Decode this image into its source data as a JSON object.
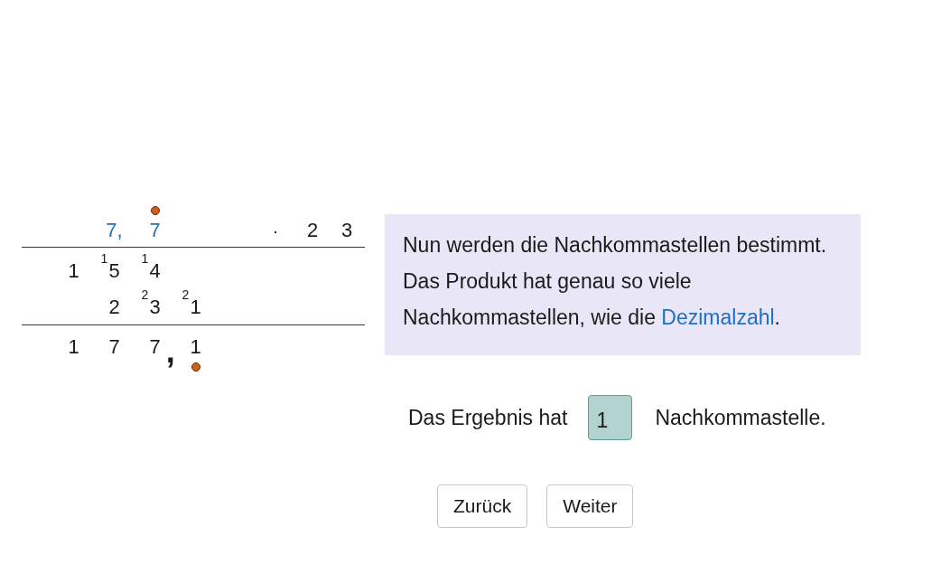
{
  "multiplication": {
    "rows": [
      {
        "kind": "factors",
        "cells": [
          {
            "kind": "gap"
          },
          {
            "kind": "digit",
            "text": "7,",
            "highlighted": true,
            "marked": false
          },
          {
            "kind": "digit",
            "text": "7",
            "highlighted": true,
            "marked": true
          },
          {
            "kind": "gap"
          },
          {
            "kind": "gap"
          },
          {
            "kind": "operator",
            "text": "·"
          },
          {
            "kind": "digit",
            "text": "2",
            "highlighted": false,
            "marked": false
          },
          {
            "kind": "digit",
            "text": "3",
            "highlighted": false,
            "marked": false
          }
        ]
      },
      {
        "kind": "partial",
        "cells": [
          {
            "kind": "digit",
            "text": "1",
            "highlighted": false,
            "marked": false
          },
          {
            "kind": "digit",
            "text": "5",
            "carry": "1",
            "highlighted": false,
            "marked": false
          },
          {
            "kind": "digit",
            "text": "4",
            "carry": "1",
            "highlighted": false,
            "marked": false
          }
        ]
      },
      {
        "kind": "partial",
        "cells": [
          {
            "kind": "gap"
          },
          {
            "kind": "digit",
            "text": "2",
            "highlighted": false,
            "marked": false
          },
          {
            "kind": "digit",
            "text": "3",
            "carry": "2",
            "highlighted": false,
            "marked": false
          },
          {
            "kind": "digit",
            "text": "1",
            "carry": "2",
            "highlighted": false,
            "marked": false
          }
        ]
      },
      {
        "kind": "result",
        "cells": [
          {
            "kind": "digit",
            "text": "1",
            "highlighted": false,
            "marked": false
          },
          {
            "kind": "digit",
            "text": "7",
            "highlighted": false,
            "marked": false
          },
          {
            "kind": "digit",
            "text": "7",
            "comma": ",",
            "highlighted": false,
            "marked": false
          },
          {
            "kind": "digit",
            "text": "1",
            "highlighted": false,
            "marked": true
          }
        ]
      }
    ]
  },
  "info_panel": {
    "parts": [
      {
        "kind": "plain",
        "text": "Nun werden die Nachkommastellen bestimmt. Das Produkt hat genau so viele Nachkommastellen, wie die "
      },
      {
        "kind": "link",
        "text": "Dezimalzahl"
      },
      {
        "kind": "plain",
        "text": "."
      }
    ]
  },
  "answer": {
    "label": "Das Ergebnis hat",
    "value": "1",
    "correct": true,
    "unit": "Nachkommastelle."
  },
  "buttons": [
    {
      "label": "Zurück"
    },
    {
      "label": "Weiter"
    }
  ]
}
